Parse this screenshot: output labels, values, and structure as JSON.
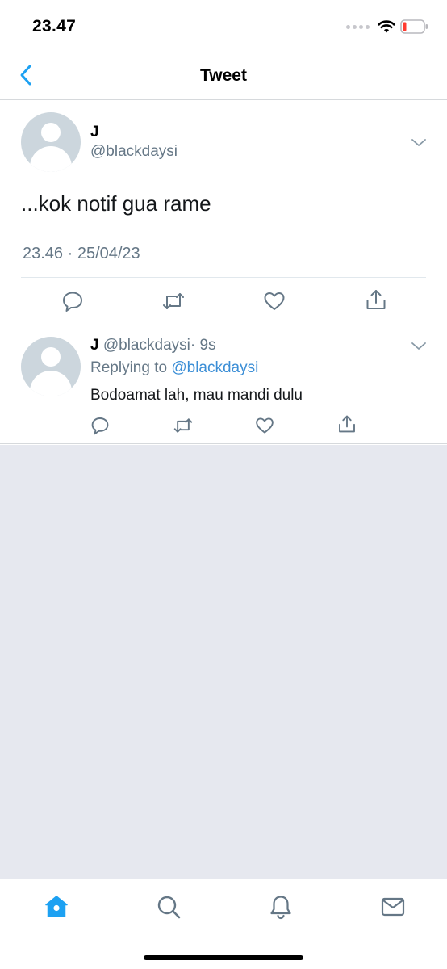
{
  "status_bar": {
    "time": "23.47",
    "signal_icon": "signal-dots-icon",
    "wifi_icon": "wifi-icon",
    "battery_icon": "battery-low-icon",
    "battery_color": "#ff3b30"
  },
  "nav": {
    "back_icon": "chevron-left-icon",
    "title": "Tweet",
    "accent_color": "#1da1f2"
  },
  "main_tweet": {
    "name": "J",
    "handle": "@blackdaysi",
    "text": "...kok notif gua rame",
    "meta": "23.46 · 25/04/23",
    "actions": [
      "reply-icon",
      "retweet-icon",
      "like-icon",
      "share-icon"
    ]
  },
  "reply": {
    "name": "J",
    "handle": "@blackdaysi",
    "time": "· 9s",
    "replying_prefix": "Replying to",
    "replying_to": "@blackdaysi",
    "text": "Bodoamat lah, mau mandi dulu",
    "actions": [
      "reply-icon",
      "retweet-icon",
      "like-icon",
      "share-icon"
    ]
  },
  "tab_bar": {
    "tabs": [
      "home-icon",
      "search-icon",
      "notifications-icon",
      "messages-icon"
    ],
    "active_tab": "home-icon",
    "active_color": "#1da1f2",
    "inactive_color": "#657786"
  }
}
